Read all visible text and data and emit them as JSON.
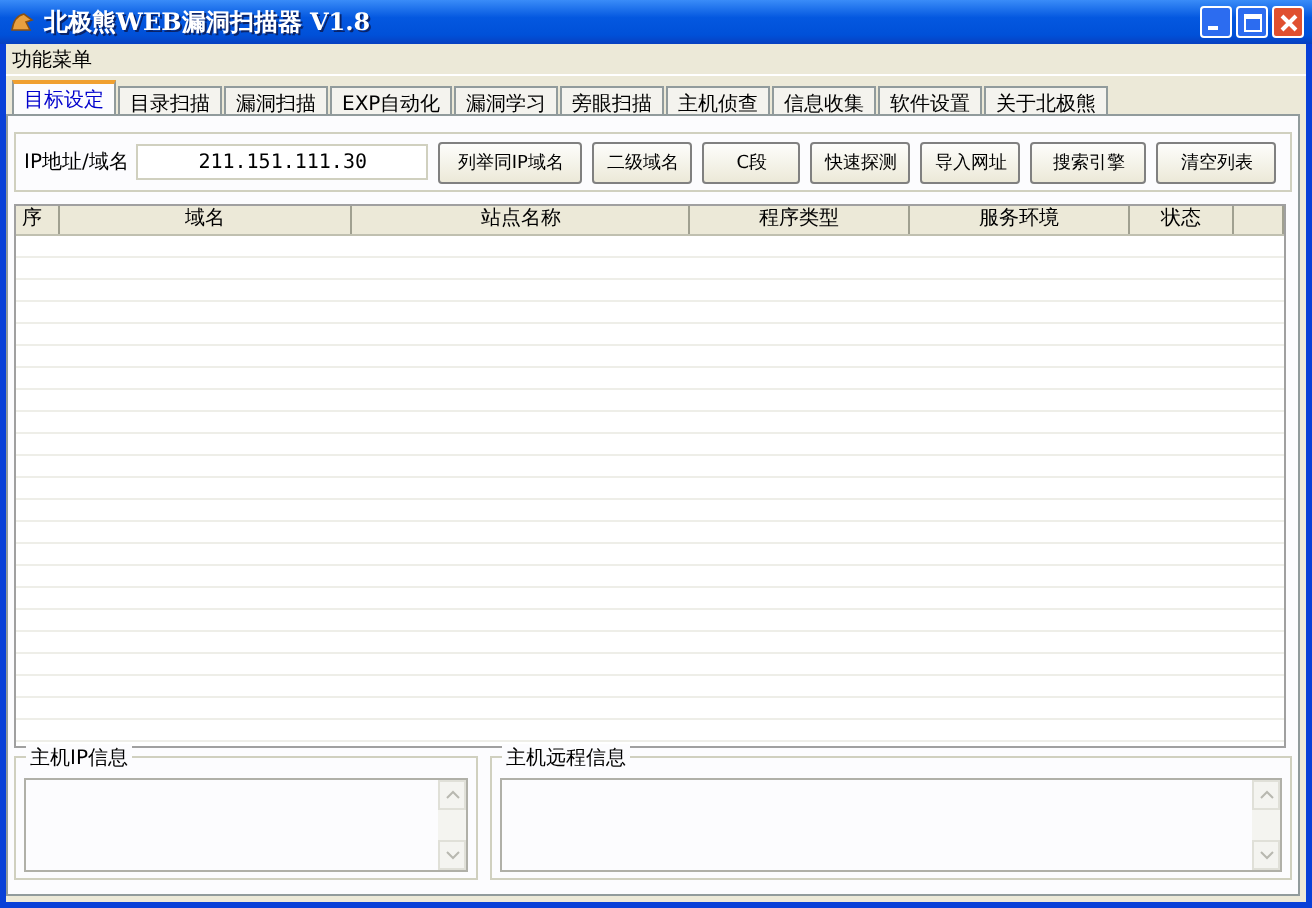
{
  "window": {
    "title": "北极熊WEB漏洞扫描器 V1.8"
  },
  "menu": [
    "功能菜单"
  ],
  "tabs": [
    {
      "label": "目标设定",
      "selected": true
    },
    {
      "label": "目录扫描",
      "selected": false
    },
    {
      "label": "漏洞扫描",
      "selected": false
    },
    {
      "label": "EXP自动化",
      "selected": false
    },
    {
      "label": "漏洞学习",
      "selected": false
    },
    {
      "label": "旁眼扫描",
      "selected": false
    },
    {
      "label": "主机侦查",
      "selected": false
    },
    {
      "label": "信息收集",
      "selected": false
    },
    {
      "label": "软件设置",
      "selected": false
    },
    {
      "label": "关于北极熊",
      "selected": false
    }
  ],
  "target": {
    "label": "IP地址/域名",
    "value": "211.151.111.30"
  },
  "buttons": [
    "列举同IP域名",
    "二级域名",
    "C段",
    "快速探测",
    "导入网址",
    "搜索引擎",
    "清空列表"
  ],
  "table": {
    "columns": [
      "序",
      "域名",
      "站点名称",
      "程序类型",
      "服务环境",
      "状态"
    ]
  },
  "panels": [
    {
      "title": "主机IP信息"
    },
    {
      "title": "主机远程信息"
    }
  ]
}
